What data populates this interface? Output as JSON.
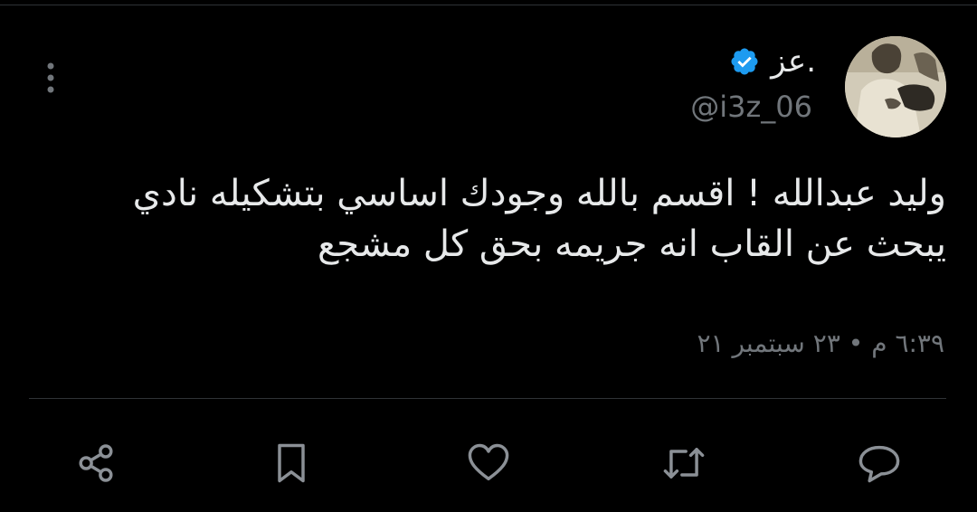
{
  "tweet": {
    "author": {
      "display_name": "عز.",
      "handle": "@i3z_06",
      "verified": true,
      "verified_color": "#1d9bf0"
    },
    "text_lines": [
      "وليد عبدالله ! اقسم بالله وجودك اساسي بتشكيله نادي",
      "يبحث عن القاب انه جريمه بحق كل مشجع"
    ],
    "timestamp": "٦:٣٩ م • ٢٣ سبتمبر ٢١"
  },
  "actions": [
    {
      "name": "share",
      "icon": "share-icon"
    },
    {
      "name": "bookmark",
      "icon": "bookmark-icon"
    },
    {
      "name": "like",
      "icon": "heart-icon"
    },
    {
      "name": "retweet",
      "icon": "retweet-icon"
    },
    {
      "name": "reply",
      "icon": "reply-icon"
    }
  ],
  "colors": {
    "background": "#000000",
    "text_primary": "#e7e9ea",
    "text_secondary": "#71767b",
    "divider": "#2f3336"
  }
}
